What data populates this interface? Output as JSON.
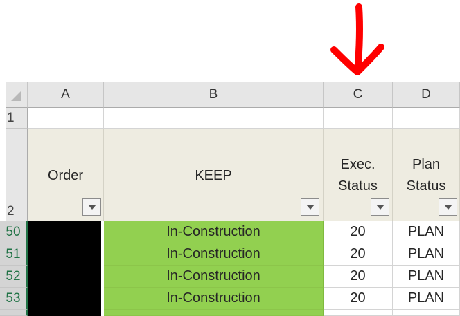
{
  "sheet": {
    "columns": [
      "A",
      "B",
      "C",
      "D"
    ],
    "rows": [
      "1",
      "2",
      "50",
      "51",
      "52",
      "53"
    ],
    "headers": {
      "order": "Order",
      "keep": "KEEP",
      "exec_line1": "Exec.",
      "exec_line2": "Status",
      "plan_line1": "Plan",
      "plan_line2": "Status"
    },
    "data_rows": [
      {
        "row_label": "50",
        "keep": "In-Construction",
        "exec": "20",
        "plan": "PLAN"
      },
      {
        "row_label": "51",
        "keep": "In-Construction",
        "exec": "20",
        "plan": "PLAN"
      },
      {
        "row_label": "52",
        "keep": "In-Construction",
        "exec": "20",
        "plan": "PLAN"
      },
      {
        "row_label": "53",
        "keep": "In-Construction",
        "exec": "20",
        "plan": "PLAN"
      }
    ]
  },
  "icons": {
    "filter": "dropdown-arrow-icon",
    "annotation": "red-down-arrow-icon"
  },
  "colors": {
    "keep_fill": "#92d050",
    "order_fill": "#000000",
    "header_fill": "#eeece1",
    "annotation": "#ff0000",
    "selection": "#217346"
  }
}
